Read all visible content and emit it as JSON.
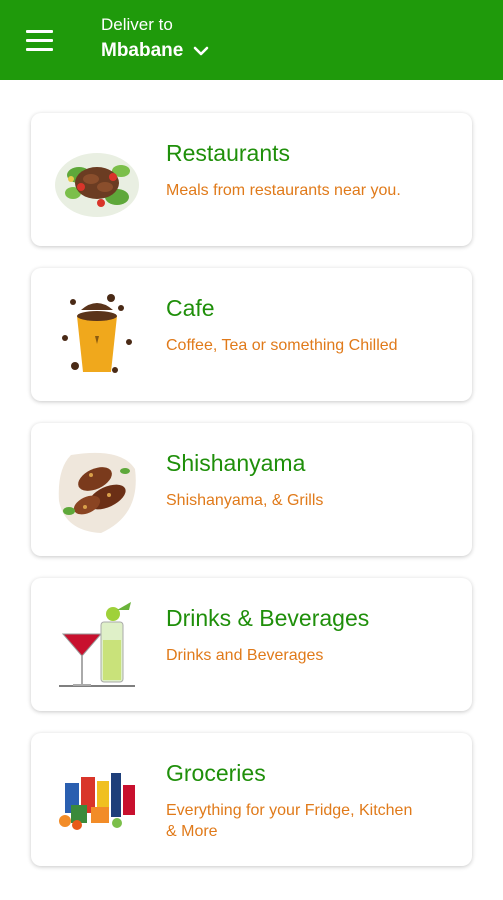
{
  "header": {
    "deliver_label": "Deliver to",
    "location": "Mbabane",
    "color": "#1f9a0b"
  },
  "categories": [
    {
      "title": "Restaurants",
      "description": "Meals from restaurants near you.",
      "icon": "salad-plate-icon"
    },
    {
      "title": "Cafe",
      "description": "Coffee, Tea or something Chilled",
      "icon": "coffee-cup-icon"
    },
    {
      "title": "Shishanyama",
      "description": "Shishanyama, & Grills",
      "icon": "grilled-meat-icon"
    },
    {
      "title": "Drinks & Beverages",
      "description": "Drinks and Beverages",
      "icon": "cocktail-glasses-icon"
    },
    {
      "title": "Groceries",
      "description": "Everything for your Fridge, Kitchen & More",
      "icon": "groceries-icon"
    }
  ],
  "colors": {
    "title": "#1f8f0a",
    "description": "#e07a1a"
  }
}
